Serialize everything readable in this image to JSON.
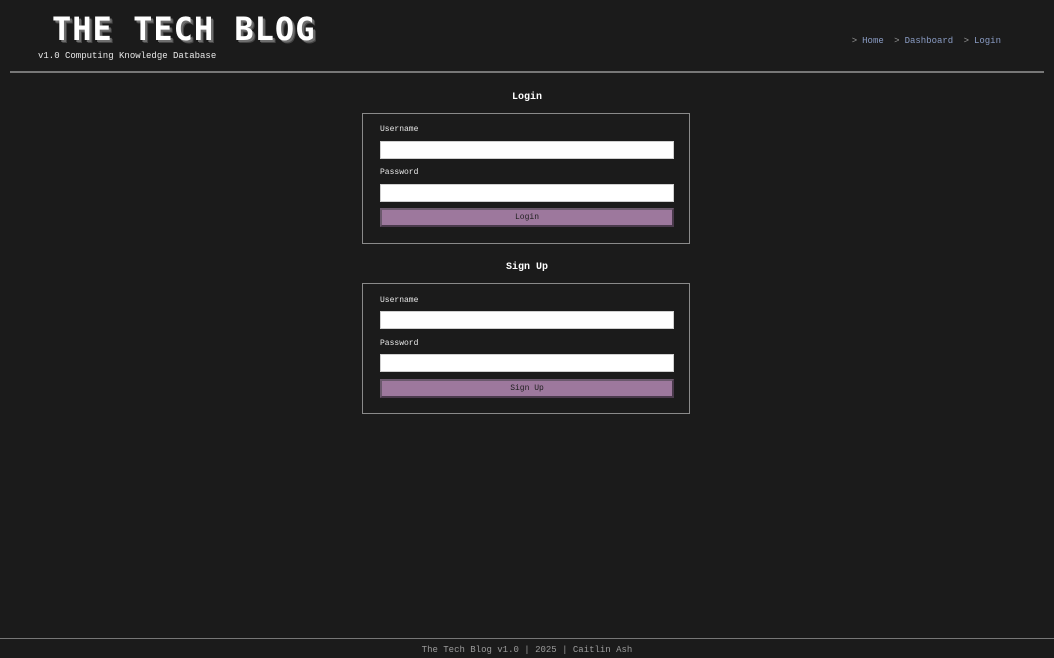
{
  "header": {
    "title": "THE TECH BLOG",
    "tagline": "v1.0 Computing Knowledge Database",
    "nav_separator": ">",
    "nav": [
      {
        "label": "Home"
      },
      {
        "label": "Dashboard"
      },
      {
        "label": "Login"
      }
    ]
  },
  "login": {
    "title": "Login",
    "username_label": "Username",
    "username_value": "",
    "password_label": "Password",
    "password_value": "",
    "button_label": "Login"
  },
  "signup": {
    "title": "Sign Up",
    "username_label": "Username",
    "username_value": "",
    "password_label": "Password",
    "password_value": "",
    "button_label": "Sign Up"
  },
  "footer": {
    "text": "The Tech Blog v1.0 | 2025 | Caitlin Ash"
  },
  "colors": {
    "background": "#1b1b1b",
    "accent_button": "#9d789d",
    "nav_link": "#8a9cc4",
    "divider": "#777777"
  }
}
